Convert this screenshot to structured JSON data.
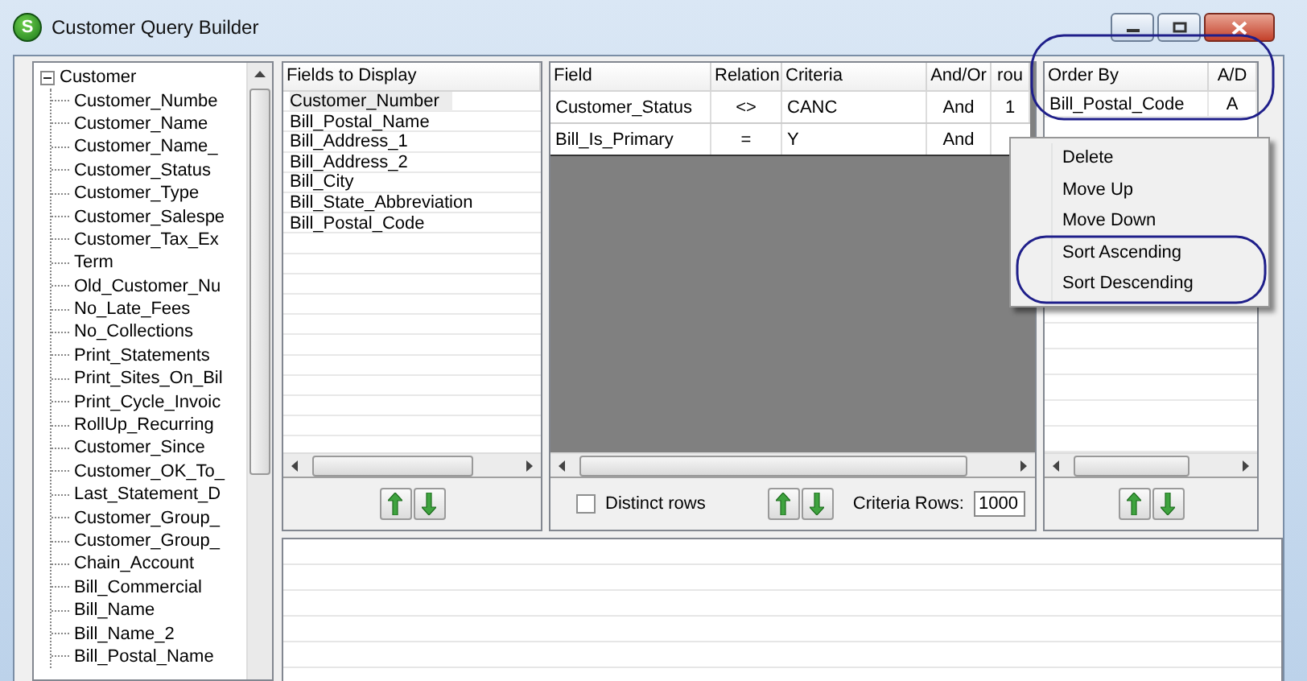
{
  "window": {
    "icon_letter": "S",
    "title": "Customer Query Builder"
  },
  "tree": {
    "label": "Customer",
    "expanded": true,
    "children": [
      {
        "label": "Customer_Numbe"
      },
      {
        "label": "Customer_Name"
      },
      {
        "label": "Customer_Name_"
      },
      {
        "label": "Customer_Status"
      },
      {
        "label": "Customer_Type"
      },
      {
        "label": "Customer_Salespe"
      },
      {
        "label": "Customer_Tax_Ex"
      },
      {
        "label": "Term"
      },
      {
        "label": "Old_Customer_Nu"
      },
      {
        "label": "No_Late_Fees"
      },
      {
        "label": "No_Collections"
      },
      {
        "label": "Print_Statements"
      },
      {
        "label": "Print_Sites_On_Bil"
      },
      {
        "label": "Print_Cycle_Invoic"
      },
      {
        "label": "RollUp_Recurring"
      },
      {
        "label": "Customer_Since"
      },
      {
        "label": "Customer_OK_To_"
      },
      {
        "label": "Last_Statement_D"
      },
      {
        "label": "Customer_Group_"
      },
      {
        "label": "Customer_Group_"
      },
      {
        "label": "Chain_Account"
      },
      {
        "label": "Bill_Commercial"
      },
      {
        "label": "Bill_Name"
      },
      {
        "label": "Bill_Name_2"
      },
      {
        "label": "Bill_Postal_Name"
      }
    ]
  },
  "fields_to_display": {
    "header": "Fields to Display",
    "rows": [
      {
        "label": "Customer_Number",
        "selected": true
      },
      {
        "label": "Bill_Postal_Name",
        "selected": false
      },
      {
        "label": "Bill_Address_1",
        "selected": false
      },
      {
        "label": "Bill_Address_2",
        "selected": false
      },
      {
        "label": "Bill_City",
        "selected": false
      },
      {
        "label": "Bill_State_Abbreviation",
        "selected": false
      },
      {
        "label": "Bill_Postal_Code",
        "selected": false
      }
    ]
  },
  "criteria": {
    "columns": [
      "Field",
      "Relation",
      "Criteria",
      "And/Or",
      "rou"
    ],
    "rows": [
      [
        "Customer_Status",
        "<>",
        "CANC",
        "And",
        "1"
      ],
      [
        "Bill_Is_Primary",
        "=",
        "Y",
        "And"
      ]
    ],
    "distinct_rows": {
      "label": "Distinct rows",
      "checked": false
    },
    "criteria_rows": {
      "label": "Criteria Rows:",
      "value": "1000"
    }
  },
  "order_by": {
    "columns": [
      "Order By",
      "A/D"
    ],
    "rows": [
      [
        "Bill_Postal_Code",
        "A"
      ]
    ]
  },
  "context_menu": {
    "items": [
      "Delete",
      "Move Up",
      "Move Down",
      "Sort Ascending",
      "Sort Descending"
    ]
  }
}
